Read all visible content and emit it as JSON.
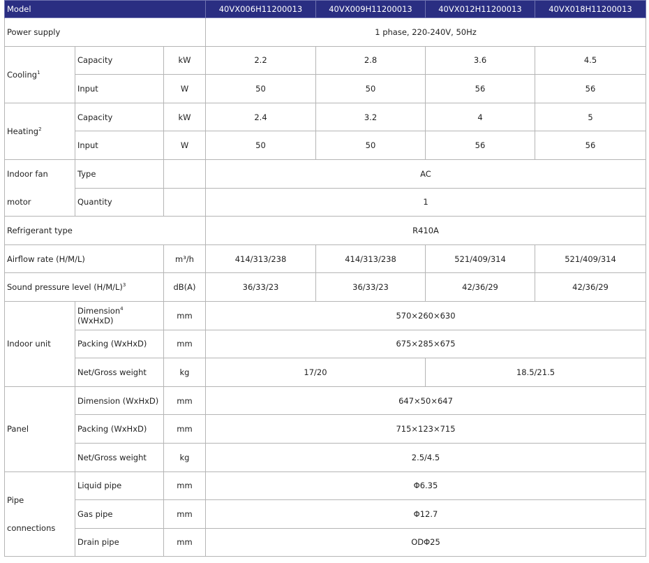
{
  "header": {
    "label": "Model",
    "models": [
      "40VX006H11200013",
      "40VX009H11200013",
      "40VX012H11200013",
      "40VX018H11200013"
    ]
  },
  "power_supply": {
    "label": "Power supply",
    "value": "1 phase, 220-240V, 50Hz"
  },
  "cooling": {
    "label": "Cooling",
    "sup": "1",
    "capacity": {
      "label": "Capacity",
      "unit": "kW",
      "values": [
        "2.2",
        "2.8",
        "3.6",
        "4.5"
      ]
    },
    "input": {
      "label": "Input",
      "unit": "W",
      "values": [
        "50",
        "50",
        "56",
        "56"
      ]
    }
  },
  "heating": {
    "label": "Heating",
    "sup": "2",
    "capacity": {
      "label": "Capacity",
      "unit": "kW",
      "values": [
        "2.4",
        "3.2",
        "4",
        "5"
      ]
    },
    "input": {
      "label": "Input",
      "unit": "W",
      "values": [
        "50",
        "50",
        "56",
        "56"
      ]
    }
  },
  "indoor_fan_motor": {
    "label_line1": "Indoor fan",
    "label_line2": "motor",
    "type": {
      "label": "Type",
      "value": "AC"
    },
    "quantity": {
      "label": "Quantity",
      "value": "1"
    }
  },
  "refrigerant": {
    "label": "Refrigerant type",
    "value": "R410A"
  },
  "airflow": {
    "label": "Airflow rate (H/M/L)",
    "unit": "m³/h",
    "values": [
      "414/313/238",
      "414/313/238",
      "521/409/314",
      "521/409/314"
    ]
  },
  "sound": {
    "label": "Sound pressure level (H/M/L)",
    "sup": "3",
    "unit": "dB(A)",
    "values": [
      "36/33/23",
      "36/33/23",
      "42/36/29",
      "42/36/29"
    ]
  },
  "indoor_unit": {
    "label": "Indoor unit",
    "dimension": {
      "label": "Dimension",
      "sup": "4",
      "label_suffix": " (WxHxD)",
      "unit": "mm",
      "value": "570×260×630"
    },
    "packing": {
      "label": "Packing (WxHxD)",
      "unit": "mm",
      "value": "675×285×675"
    },
    "weight": {
      "label": "Net/Gross weight",
      "unit": "kg",
      "values": [
        "17/20",
        "18.5/21.5"
      ]
    }
  },
  "panel": {
    "label": "Panel",
    "dimension": {
      "label": "Dimension (WxHxD)",
      "unit": "mm",
      "value": "647×50×647"
    },
    "packing": {
      "label": "Packing (WxHxD)",
      "unit": "mm",
      "value": "715×123×715"
    },
    "weight": {
      "label": "Net/Gross weight",
      "unit": "kg",
      "value": "2.5/4.5"
    }
  },
  "pipe": {
    "label_line1": "Pipe",
    "label_line2": "connections",
    "liquid": {
      "label": "Liquid pipe",
      "unit": "mm",
      "value": "Φ6.35"
    },
    "gas": {
      "label": "Gas pipe",
      "unit": "mm",
      "value": "Φ12.7"
    },
    "drain": {
      "label": "Drain pipe",
      "unit": "mm",
      "value": "ODΦ25"
    }
  }
}
